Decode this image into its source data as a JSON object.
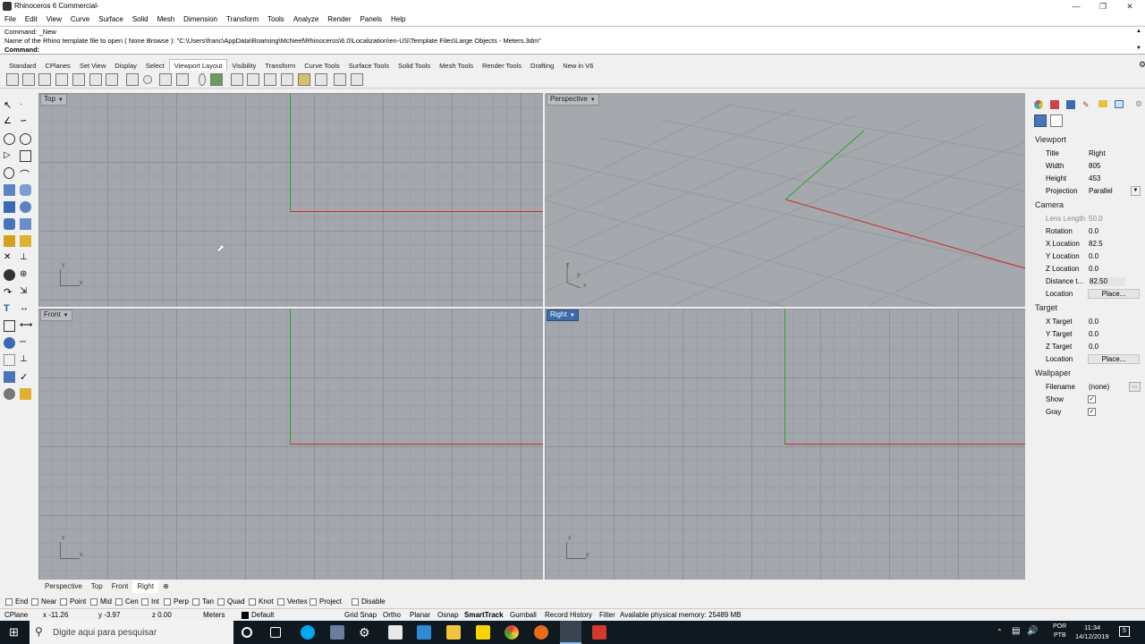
{
  "window": {
    "title": "Rhinoceros 6 Commercial-"
  },
  "menu": [
    "File",
    "Edit",
    "View",
    "Curve",
    "Surface",
    "Solid",
    "Mesh",
    "Dimension",
    "Transform",
    "Tools",
    "Analyze",
    "Render",
    "Panels",
    "Help"
  ],
  "command": {
    "line1": "Command: _New",
    "line2": "Name of the Rhino template file to open ( None  Browse ): \"C:\\Users\\franc\\AppData\\Roaming\\McNeel\\Rhinoceros\\6.0\\Localization\\en-US\\Template Files\\Large Objects - Meters.3dm\"",
    "prompt": "Command:"
  },
  "toolbar_tabs": [
    "Standard",
    "CPlanes",
    "Set View",
    "Display",
    "Select",
    "Viewport Layout",
    "Visibility",
    "Transform",
    "Curve Tools",
    "Surface Tools",
    "Solid Tools",
    "Mesh Tools",
    "Render Tools",
    "Drafting",
    "New in V6"
  ],
  "active_tab": "Viewport Layout",
  "viewports": {
    "top": "Top",
    "perspective": "Perspective",
    "front": "Front",
    "right": "Right"
  },
  "axis_labels": {
    "x": "x",
    "y": "y",
    "z": "z"
  },
  "viewport_tabs": [
    "Perspective",
    "Top",
    "Front",
    "Right"
  ],
  "osnaps": [
    "End",
    "Near",
    "Point",
    "Mid",
    "Cen",
    "Int",
    "Perp",
    "Tan",
    "Quad",
    "Knot",
    "Vertex",
    "Project",
    "Disable"
  ],
  "status": {
    "cplane": "CPlane",
    "x": "x -11.26",
    "y": "y -3.97",
    "z": "z 0.00",
    "units": "Meters",
    "layer": "Default",
    "grid_snap": "Grid Snap",
    "ortho": "Ortho",
    "planar": "Planar",
    "osnap": "Osnap",
    "smarttrack": "SmartTrack",
    "gumball": "Gumball",
    "record_history": "Record History",
    "filter": "Filter",
    "memory": "Available physical memory: 25489 MB"
  },
  "properties": {
    "viewport_section": "Viewport",
    "title_label": "Title",
    "title_value": "Right",
    "width_label": "Width",
    "width_value": "805",
    "height_label": "Height",
    "height_value": "453",
    "projection_label": "Projection",
    "projection_value": "Parallel",
    "camera_section": "Camera",
    "lens_label": "Lens Length",
    "lens_value": "50.0",
    "rotation_label": "Rotation",
    "rotation_value": "0.0",
    "xloc_label": "X Location",
    "xloc_value": "82.5",
    "yloc_label": "Y Location",
    "yloc_value": "0.0",
    "zloc_label": "Z Location",
    "zloc_value": "0.0",
    "dist_label": "Distance t...",
    "dist_value": "82.50",
    "loc_label": "Location",
    "place_button": "Place...",
    "target_section": "Target",
    "xt_label": "X Target",
    "xt_value": "0.0",
    "yt_label": "Y Target",
    "yt_value": "0.0",
    "zt_label": "Z Target",
    "zt_value": "0.0",
    "tloc_label": "Location",
    "tplace_button": "Place...",
    "wallpaper_section": "Wallpaper",
    "filename_label": "Filename",
    "filename_value": "(none)",
    "browse_button": "...",
    "show_label": "Show",
    "gray_label": "Gray"
  },
  "taskbar": {
    "search_placeholder": "Digite aqui para pesquisar",
    "lang1": "POR",
    "lang2": "PTB",
    "time": "11:34",
    "date": "14/12/2019",
    "notif": "5"
  }
}
